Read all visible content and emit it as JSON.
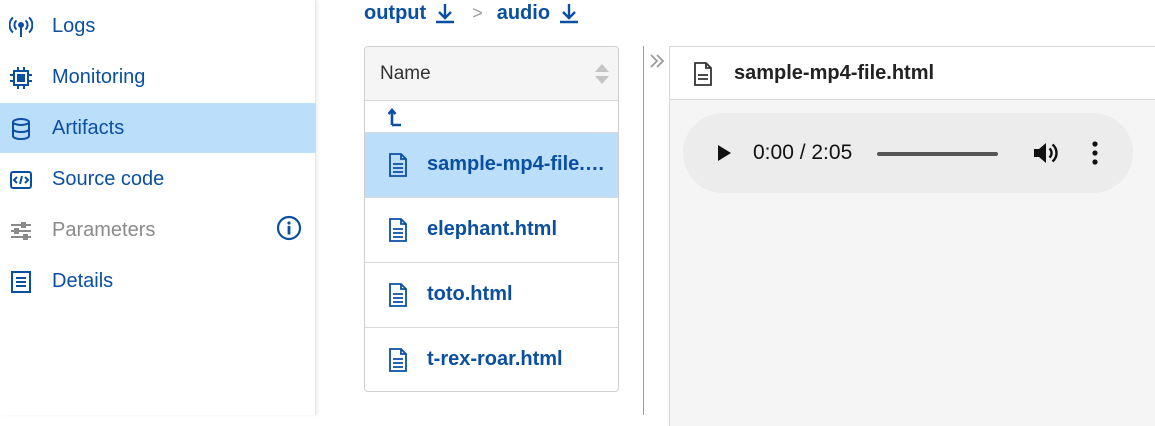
{
  "sidebar": {
    "items": [
      {
        "label": "Logs",
        "icon": "antenna-icon",
        "state": "normal"
      },
      {
        "label": "Monitoring",
        "icon": "chip-icon",
        "state": "normal"
      },
      {
        "label": "Artifacts",
        "icon": "database-icon",
        "state": "active"
      },
      {
        "label": "Source code",
        "icon": "code-icon",
        "state": "normal"
      },
      {
        "label": "Parameters",
        "icon": "sliders-icon",
        "state": "disabled"
      },
      {
        "label": "Details",
        "icon": "document-list-icon",
        "state": "normal"
      }
    ]
  },
  "breadcrumb": {
    "items": [
      {
        "label": "output"
      },
      {
        "label": "audio"
      }
    ],
    "separator": ">"
  },
  "file_list": {
    "header": "Name",
    "files": [
      {
        "name": "sample-mp4-file.html",
        "selected": true
      },
      {
        "name": "elephant.html",
        "selected": false
      },
      {
        "name": "toto.html",
        "selected": false
      },
      {
        "name": "t-rex-roar.html",
        "selected": false
      }
    ]
  },
  "viewer": {
    "title": "sample-mp4-file.html",
    "player": {
      "time": "0:00 / 2:05",
      "progress": 0
    }
  },
  "colors": {
    "accent": "#0b4fa2",
    "active_bg": "#bbdefb",
    "disabled": "#8a8a8a"
  }
}
